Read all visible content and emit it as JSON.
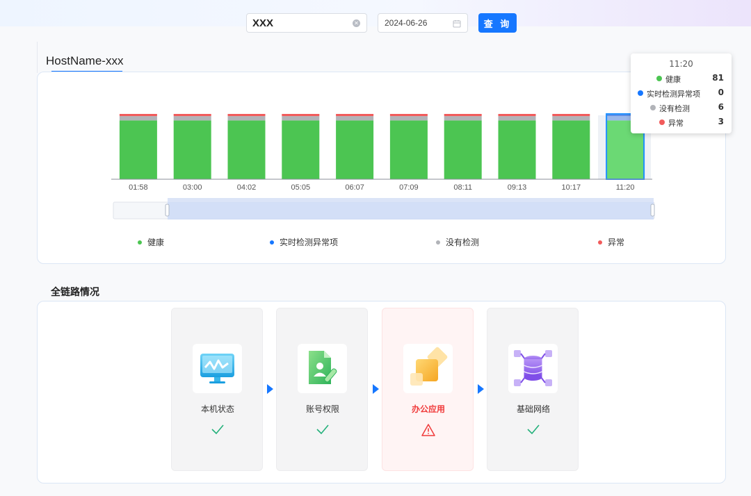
{
  "search": {
    "value": "XXX",
    "placeholder": ""
  },
  "date": {
    "value": "2024-06-26"
  },
  "query_button": {
    "label": "查 询"
  },
  "host": {
    "title": "HostName-xxx"
  },
  "colors": {
    "healthy": "#4cc552",
    "realtime": "#1677ff",
    "nodetect": "#b1b3b8",
    "abnormal": "#f15b5b",
    "accent": "#1677ff"
  },
  "chart_data": {
    "type": "bar",
    "stacked": true,
    "categories": [
      "01:58",
      "03:00",
      "04:02",
      "05:05",
      "06:07",
      "07:09",
      "08:11",
      "09:13",
      "10:17",
      "11:20"
    ],
    "series": [
      {
        "name": "健康",
        "values": [
          81,
          81,
          81,
          81,
          81,
          81,
          81,
          81,
          81,
          81
        ]
      },
      {
        "name": "实时检测异常项",
        "values": [
          0,
          0,
          0,
          0,
          0,
          0,
          0,
          0,
          0,
          0
        ]
      },
      {
        "name": "没有检测",
        "values": [
          6,
          6,
          6,
          6,
          6,
          6,
          6,
          6,
          6,
          6
        ]
      },
      {
        "name": "异常",
        "values": [
          3,
          3,
          3,
          3,
          3,
          3,
          3,
          3,
          3,
          3
        ]
      }
    ],
    "ylim": [
      0,
      90
    ],
    "highlighted_category": "11:20",
    "legend_position": "bottom",
    "grid": false
  },
  "legend": [
    {
      "label": "健康"
    },
    {
      "label": "实时检测异常项"
    },
    {
      "label": "没有检测"
    },
    {
      "label": "异常"
    }
  ],
  "tooltip": {
    "time": "11:20",
    "rows": [
      {
        "label": "健康",
        "value": "81"
      },
      {
        "label": "实时检测异常项",
        "value": "0"
      },
      {
        "label": "没有检测",
        "value": "6"
      },
      {
        "label": "异常",
        "value": "3"
      }
    ]
  },
  "link_section": {
    "title": "全链路情况",
    "cards": [
      {
        "label": "本机状态",
        "icon": "monitor-icon",
        "status": "ok"
      },
      {
        "label": "账号权限",
        "icon": "account-document-icon",
        "status": "ok"
      },
      {
        "label": "办公应用",
        "icon": "office-app-icon",
        "status": "warning"
      },
      {
        "label": "基础网络",
        "icon": "database-network-icon",
        "status": "ok"
      }
    ]
  }
}
